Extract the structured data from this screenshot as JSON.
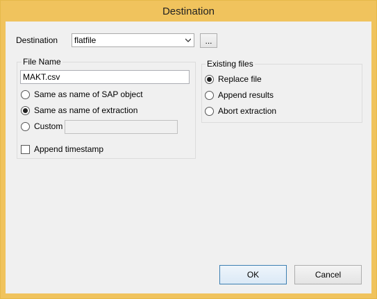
{
  "window": {
    "title": "Destination"
  },
  "destination": {
    "label": "Destination",
    "value": "flatfile",
    "browse_label": "..."
  },
  "file_name": {
    "group_label": "File Name",
    "value": "MAKT.csv",
    "options": [
      {
        "label": "Same as name of SAP object",
        "selected": false
      },
      {
        "label": "Same as name of extraction",
        "selected": true
      },
      {
        "label": "Custom",
        "selected": false
      }
    ],
    "custom_value": "",
    "append_timestamp": {
      "label": "Append timestamp",
      "checked": false
    }
  },
  "existing_files": {
    "group_label": "Existing files",
    "options": [
      {
        "label": "Replace file",
        "selected": true
      },
      {
        "label": "Append results",
        "selected": false
      },
      {
        "label": "Abort extraction",
        "selected": false
      }
    ]
  },
  "buttons": {
    "ok": "OK",
    "cancel": "Cancel"
  },
  "colors": {
    "titlebar": "#f0c35d",
    "client": "#f0f0f0"
  }
}
